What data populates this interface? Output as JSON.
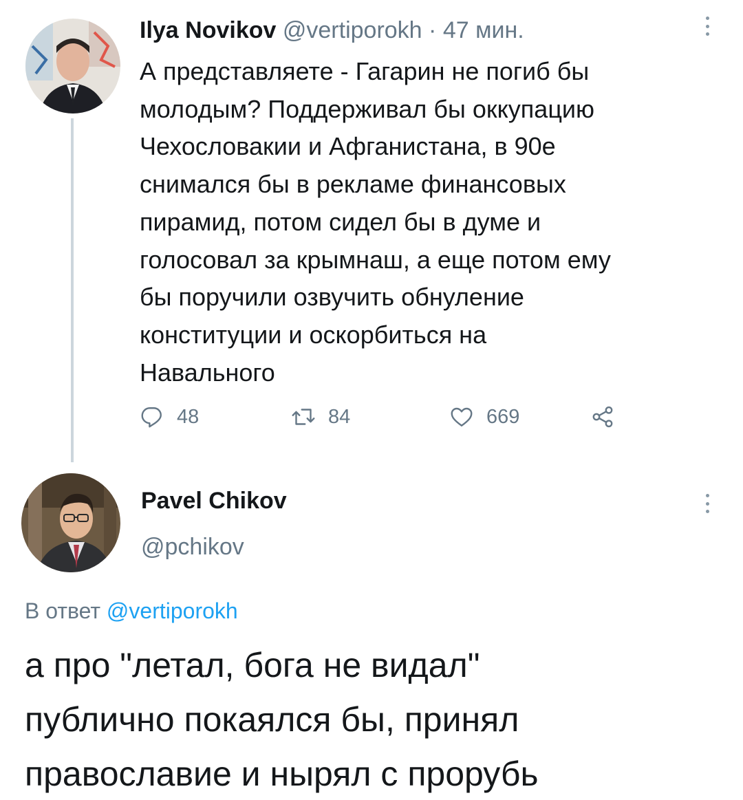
{
  "tweet1": {
    "author_name": "Ilya Novikov",
    "handle": "@vertiporokh",
    "separator": "·",
    "time": "47 мин.",
    "text": "А представляете - Гагарин не погиб бы\nмолодым? Поддерживал бы оккупацию\nЧехословакии и Афганистана, в 90е\nснимался бы в рекламе финансовых\nпирамид, потом сидел бы в думе и\nголосовал за крымнаш, а еще потом ему\nбы поручили озвучить обнуление\nконституции и оскорбиться на\nНавального",
    "actions": {
      "replies": "48",
      "retweets": "84",
      "likes": "669"
    }
  },
  "tweet2": {
    "author_name": "Pavel Chikov",
    "handle": "@pchikov",
    "reply_prefix": "В ответ",
    "reply_handle": "@vertiporokh",
    "text": "а про \"летал, бога не видал\"\nпублично покаялся бы, принял\nправославие и нырял с прорубь"
  },
  "colors": {
    "text": "#14171a",
    "secondary": "#657786",
    "link": "#1da1f2",
    "thread_line": "#ccd6dd"
  },
  "icons": [
    "reply-icon",
    "retweet-icon",
    "like-icon",
    "share-icon",
    "more-icon"
  ]
}
